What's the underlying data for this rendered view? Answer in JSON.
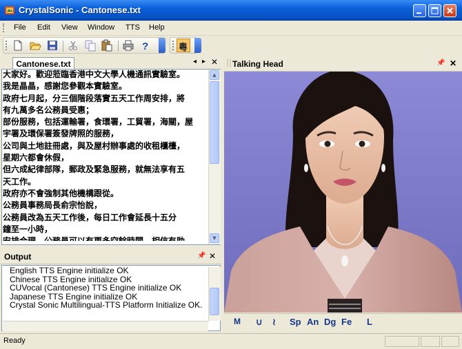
{
  "window": {
    "title": "CrystalSonic - Cantonese.txt"
  },
  "menu": [
    "File",
    "Edit",
    "View",
    "Window",
    "TTS",
    "Help"
  ],
  "toolbar": {
    "buttons": [
      "new-file-icon",
      "open-folder-icon",
      "save-icon",
      "cut-icon",
      "copy-icon",
      "paste-icon",
      "print-icon",
      "help-icon",
      "cantonese-mode-icon"
    ],
    "cantonese_glyph": "粵"
  },
  "editor": {
    "tab_label": "Cantonese.txt",
    "lines": [
      "大家好。歡迎蒞臨香港中文大學人機通訊實驗室。",
      "我是晶晶，感謝您參觀本實驗室。",
      "政府七月起，分三個階段落實五天工作周安排，將",
      "有九萬多名公務員受惠；",
      "部份服務，包括運輸署，食環署，工貿署，海關，屋",
      "宇署及環保署簽發牌照的服務，",
      "公司與土地註冊處，與及屋村辦事處的收租櫃檯，",
      "星期六都會休假，",
      "但六成紀律部隊，郵政及緊急服務，就無法享有五",
      "天工作。",
      "政府亦不會強制其他機構跟從。",
      "公務員事務局長俞宗怡說，",
      "公務員改為五天工作後，每日工作會延長十五分",
      "鐘至一小時，",
      "安排合理，公務員可以有更多空餘時間，相信有助"
    ]
  },
  "output": {
    "title": "Output",
    "lines": [
      "English TTS Engine initialize OK",
      "Chinese TTS Engine initialize OK",
      "CUVocal (Cantonese) TTS Engine initialize OK",
      "Japanese TTS Engine initialize OK",
      "Crystal Sonic Multilingual-TTS Platform Initialize OK."
    ]
  },
  "talking_head": {
    "title": "Talking Head",
    "controls": [
      "M",
      "∪",
      "≀",
      "Sp",
      "An",
      "Dg",
      "Fe",
      "L"
    ]
  },
  "status": {
    "text": "Ready"
  },
  "colors": {
    "accent": "#0a5fd9",
    "head_bg": "#7d7cc9",
    "xp_face": "#ece9d8"
  }
}
